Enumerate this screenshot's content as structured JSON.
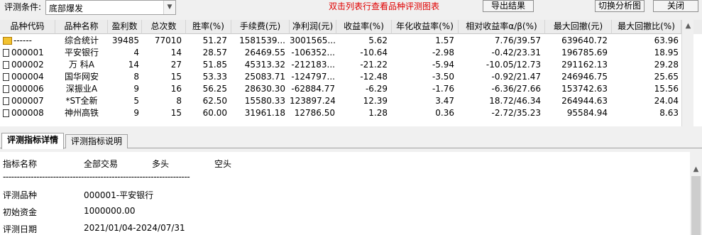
{
  "top": {
    "condition_label": "评测条件:",
    "condition_value": "底部爆发",
    "hint": "双击列表行查看品种评测图表",
    "export_label": "导出结果",
    "switch_label": "切换分析图",
    "close_label": "关闭"
  },
  "table": {
    "columns": [
      "品种代码",
      "品种名称",
      "盈利数",
      "总次数",
      "胜率(%)",
      "手续费(元)",
      "净利润(元)",
      "收益率(%)",
      "年化收益率(%)",
      "相对收益率α/β(%)",
      "最大回撤(元)",
      "最大回撤比(%)"
    ],
    "rows": [
      [
        "------",
        "综合统计",
        "39485",
        "77010",
        "51.27",
        "1581539...",
        "3001565...",
        "5.62",
        "1.57",
        "7.76/39.57",
        "639640.72",
        "63.96"
      ],
      [
        "000001",
        "平安银行",
        "4",
        "14",
        "28.57",
        "26469.55",
        "-106352...",
        "-10.64",
        "-2.98",
        "-0.42/23.31",
        "196785.69",
        "18.95"
      ],
      [
        "000002",
        "万 科A",
        "14",
        "27",
        "51.85",
        "45313.32",
        "-212183...",
        "-21.22",
        "-5.94",
        "-10.05/12.73",
        "291162.13",
        "29.28"
      ],
      [
        "000004",
        "国华网安",
        "8",
        "15",
        "53.33",
        "25083.71",
        "-124797...",
        "-12.48",
        "-3.50",
        "-0.92/21.47",
        "246946.75",
        "25.65"
      ],
      [
        "000006",
        "深振业A",
        "9",
        "16",
        "56.25",
        "28630.30",
        "-62884.77",
        "-6.29",
        "-1.76",
        "-6.36/27.66",
        "153742.63",
        "15.56"
      ],
      [
        "000007",
        "*ST全新",
        "5",
        "8",
        "62.50",
        "15580.33",
        "123897.24",
        "12.39",
        "3.47",
        "18.72/46.34",
        "264944.63",
        "24.04"
      ],
      [
        "000008",
        "神州高铁",
        "9",
        "15",
        "60.00",
        "31961.18",
        "12786.50",
        "1.28",
        "0.36",
        "-2.72/35.23",
        "95584.94",
        "8.63"
      ]
    ]
  },
  "tabs": [
    "评测指标详情",
    "评测指标说明"
  ],
  "detail": {
    "header": [
      "指标名称",
      "全部交易",
      "多头",
      "空头"
    ],
    "divider": "-------------------------------------------------------------------",
    "items": [
      {
        "label": "评测品种",
        "value": "000001-平安银行"
      },
      {
        "label": "初始资金",
        "value": "1000000.00"
      },
      {
        "label": "评测日期",
        "value": "2021/01/04-2024/07/31"
      }
    ]
  },
  "colors": {
    "hint": "#e00000",
    "summary_icon": "#f2c230"
  },
  "icons": {
    "summary_row": "folder-sum-icon",
    "stock_row": "document-icon"
  }
}
